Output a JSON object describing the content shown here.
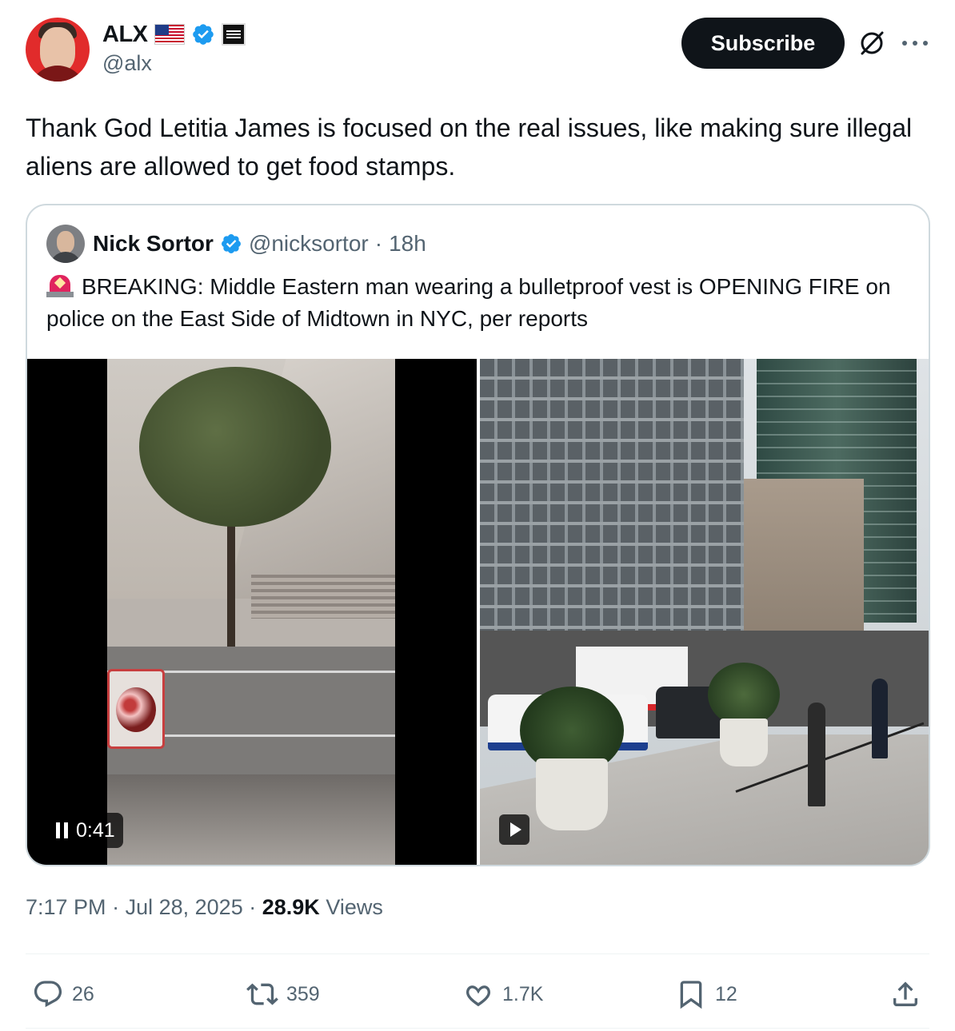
{
  "author": {
    "display_name": "ALX",
    "handle": "@alx",
    "flag_icon": "us-flag-icon",
    "verified_color": "#1d9bf0"
  },
  "header": {
    "subscribe_label": "Subscribe"
  },
  "tweet": {
    "text": "Thank God Letitia James is focused on the real issues, like making sure illegal aliens are allowed to get food stamps."
  },
  "quote": {
    "display_name": "Nick Sortor",
    "handle": "@nicksortor",
    "separator": "·",
    "age": "18h",
    "text": "BREAKING: Middle Eastern man wearing a bulletproof vest is OPENING FIRE on police on the East Side of Midtown in NYC, per reports",
    "media": {
      "video_duration": "0:41"
    }
  },
  "meta": {
    "time": "7:17 PM",
    "sep1": "·",
    "date": "Jul 28, 2025",
    "sep2": "·",
    "views_count": "28.9K",
    "views_label": "Views"
  },
  "actions": {
    "replies": "26",
    "reposts": "359",
    "likes": "1.7K",
    "bookmarks": "12"
  }
}
